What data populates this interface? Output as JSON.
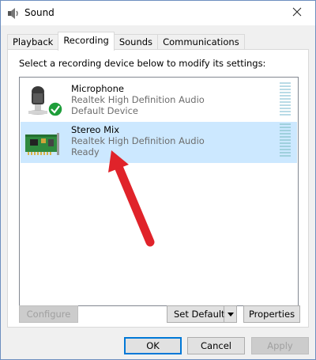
{
  "window": {
    "title": "Sound",
    "title_icon": "speaker-icon",
    "close_icon": "close-icon"
  },
  "tabs": [
    {
      "label": "Playback",
      "active": false
    },
    {
      "label": "Recording",
      "active": true
    },
    {
      "label": "Sounds",
      "active": false
    },
    {
      "label": "Communications",
      "active": false
    }
  ],
  "panel": {
    "instruction": "Select a recording device below to modify its settings:",
    "devices": [
      {
        "name": "Microphone",
        "driver": "Realtek High Definition Audio",
        "status": "Default Device",
        "icon": "microphone-icon",
        "selected": false
      },
      {
        "name": "Stereo Mix",
        "driver": "Realtek High Definition Audio",
        "status": "Ready",
        "icon": "sound-card-icon",
        "selected": true
      }
    ],
    "configure_label": "Configure",
    "set_default_label": "Set Default",
    "properties_label": "Properties"
  },
  "footer": {
    "ok_label": "OK",
    "cancel_label": "Cancel",
    "apply_label": "Apply"
  },
  "annotation": {
    "arrow_color": "#e0232a"
  }
}
